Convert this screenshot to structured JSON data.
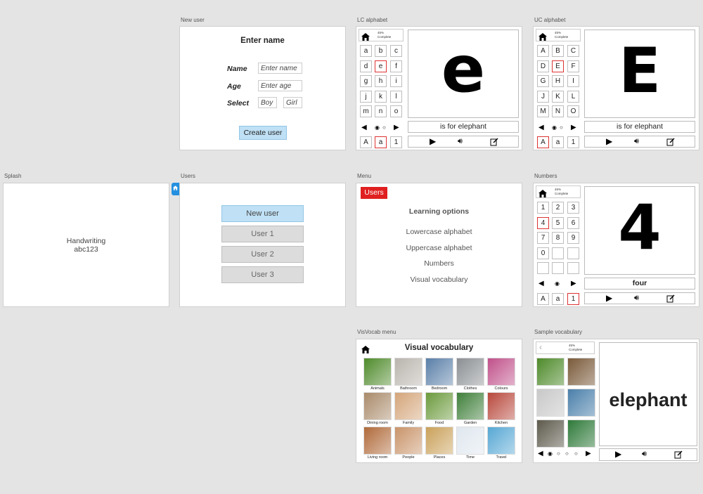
{
  "frames": {
    "new_user": "New user",
    "lc_alphabet": "LC alphabet",
    "uc_alphabet": "UC alphabet",
    "splash": "Splash",
    "users": "Users",
    "menu": "Menu",
    "numbers": "Numbers",
    "visvocab_menu": "VisVocab menu",
    "sample_vocab": "Sample vocabulary"
  },
  "new_user": {
    "title": "Enter name",
    "name_label": "Name",
    "name_placeholder": "Enter name",
    "age_label": "Age",
    "age_placeholder": "Enter age",
    "select_label": "Select",
    "boy": "Boy",
    "girl": "Girl",
    "create_button": "Create user"
  },
  "progress": {
    "percent": "45%",
    "label": "Complete"
  },
  "lc": {
    "letters": [
      "a",
      "b",
      "c",
      "d",
      "e",
      "f",
      "g",
      "h",
      "i",
      "j",
      "k",
      "l",
      "m",
      "n",
      "o"
    ],
    "selected_index": 4,
    "big_letter": "e",
    "caption": "is for elephant",
    "case_upper": "A",
    "case_lower": "a",
    "case_number": "1",
    "active_case": "lower"
  },
  "uc": {
    "letters": [
      "A",
      "B",
      "C",
      "D",
      "E",
      "F",
      "G",
      "H",
      "I",
      "J",
      "K",
      "L",
      "M",
      "N",
      "O"
    ],
    "selected_index": 4,
    "big_letter": "E",
    "caption": "is for elephant",
    "case_upper": "A",
    "case_lower": "a",
    "case_number": "1",
    "active_case": "upper"
  },
  "numbers": {
    "digits": [
      "1",
      "2",
      "3",
      "4",
      "5",
      "6",
      "7",
      "8",
      "9",
      "0",
      "",
      "",
      "",
      "",
      ""
    ],
    "selected_index": 3,
    "big_digit": "4",
    "caption": "four",
    "case_upper": "A",
    "case_lower": "a",
    "case_number": "1",
    "active_case": "number"
  },
  "splash": {
    "line1": "Handwriting",
    "line2": "abc123"
  },
  "users": {
    "new_user": "New user",
    "items": [
      "User 1",
      "User 2",
      "User 3"
    ]
  },
  "menu": {
    "users_button": "Users",
    "heading": "Learning options",
    "options": [
      "Lowercase alphabet",
      "Uppercase alphabet",
      "Numbers",
      "Visual vocabulary"
    ]
  },
  "visvocab": {
    "title": "Visual vocabulary",
    "categories": [
      {
        "label": "Animals",
        "color": "#4e8a2a"
      },
      {
        "label": "Bathroom",
        "color": "#b9b4ad"
      },
      {
        "label": "Bedroom",
        "color": "#5a7fa8"
      },
      {
        "label": "Clothes",
        "color": "#8b8f93"
      },
      {
        "label": "Colours",
        "color": "#c0508a"
      },
      {
        "label": "Dining room",
        "color": "#a98a6a"
      },
      {
        "label": "Family",
        "color": "#d4a57a"
      },
      {
        "label": "Food",
        "color": "#6b9a3c"
      },
      {
        "label": "Garden",
        "color": "#3f7f3a"
      },
      {
        "label": "Kitchen",
        "color": "#b8483c"
      },
      {
        "label": "Living room",
        "color": "#b06a3a"
      },
      {
        "label": "People",
        "color": "#c9946a"
      },
      {
        "label": "Places",
        "color": "#caa15a"
      },
      {
        "label": "Time",
        "color": "#dfe7ee"
      },
      {
        "label": "Travel",
        "color": "#56a7d4"
      }
    ]
  },
  "sample_vocab": {
    "word": "elephant",
    "thumbs": [
      "#4e8a2a",
      "#7a5a3a",
      "#c8c8c8",
      "#4a7faa",
      "#5d5a4c",
      "#2f7a3a"
    ]
  },
  "colors": {
    "accent_blue": "#bfe0f5",
    "red": "#e02020",
    "tab_blue": "#2590e0"
  }
}
